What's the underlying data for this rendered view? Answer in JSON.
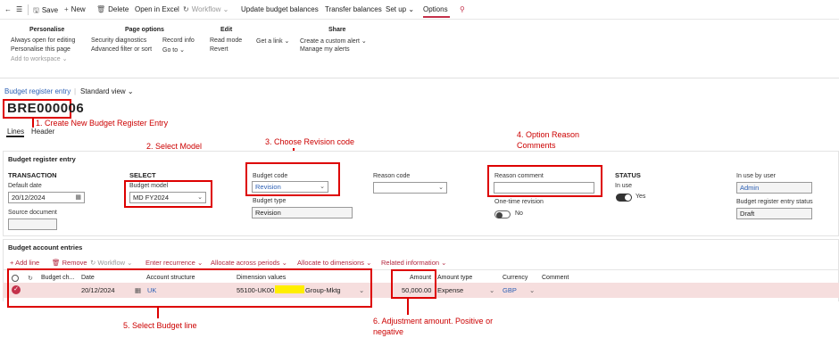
{
  "toolbar": {
    "save": "Save",
    "new": "New",
    "delete": "Delete",
    "open_in_excel": "Open in Excel",
    "workflow": "Workflow",
    "update_budget_balances": "Update budget balances",
    "transfer_balances": "Transfer balances",
    "set_up": "Set up",
    "options": "Options"
  },
  "ribbon": {
    "personalise": {
      "title": "Personalise",
      "items": [
        "Always open for editing",
        "Personalise this page",
        "Add to workspace"
      ]
    },
    "page_options": {
      "title": "Page options",
      "col1": [
        "Security diagnostics",
        "Advanced filter or sort"
      ],
      "col2": [
        "Record info",
        "Go to"
      ]
    },
    "edit": {
      "title": "Edit",
      "items": [
        "Read mode",
        "Revert"
      ]
    },
    "get_a_link": "Get a link",
    "share": {
      "title": "Share",
      "items": [
        "Create a custom alert",
        "Manage my alerts"
      ]
    }
  },
  "breadcrumb": {
    "link": "Budget register entry",
    "view": "Standard view"
  },
  "record_title": "BRE000006",
  "tabs": [
    "Lines",
    "Header"
  ],
  "annotations": {
    "a1": "1. Create New Budget Register Entry",
    "a2": "2. Select Model",
    "a3": "3. Choose Revision code",
    "a4_line1": "4. Option Reason",
    "a4_line2": "Comments",
    "a5": "5. Select Budget line",
    "a6_line1": "6. Adjustment amount. Positive or",
    "a6_line2": "negative"
  },
  "entry": {
    "panel_title": "Budget register entry",
    "transaction_h": "TRANSACTION",
    "default_date_label": "Default date",
    "default_date": "20/12/2024",
    "source_document_label": "Source document",
    "source_document": "",
    "select_h": "SELECT",
    "budget_model_label": "Budget model",
    "budget_model": "MD FY2024",
    "budget_code_label": "Budget code",
    "budget_code": "Revision",
    "budget_type_label": "Budget type",
    "budget_type": "Revision",
    "reason_code_label": "Reason code",
    "reason_code": "",
    "reason_comment_label": "Reason comment",
    "reason_comment": "",
    "one_time_revision_label": "One-time revision",
    "one_time_revision": "No",
    "status_h": "STATUS",
    "in_use_label": "In use",
    "in_use": "Yes",
    "in_use_by_user_label": "In use by user",
    "in_use_by_user": "Admin",
    "entry_status_label": "Budget register entry status",
    "entry_status": "Draft"
  },
  "accounts": {
    "panel_title": "Budget account entries",
    "actions": {
      "add_line": "Add line",
      "remove": "Remove",
      "workflow": "Workflow",
      "enter_recurrence": "Enter recurrence",
      "allocate_periods": "Allocate across periods",
      "allocate_dimensions": "Allocate to dimensions",
      "related_information": "Related information"
    },
    "columns": [
      "Budget ch...",
      "Date",
      "Account structure",
      "Dimension values",
      "Amount",
      "Amount type",
      "Currency",
      "Comment"
    ],
    "rows": [
      {
        "date": "20/12/2024",
        "account_structure": "UK",
        "dimension_prefix": "55100-UK00",
        "dimension_suffix": "Group-Mktg",
        "amount": "50,000.00",
        "amount_type": "Expense",
        "currency": "GBP",
        "comment": ""
      }
    ]
  },
  "colors": {
    "accent": "#c4314b",
    "annotation_red": "#dd0000",
    "link_blue": "#2b5fb4",
    "row_selected": "#f6dede",
    "highlight_yellow": "#ffee00"
  }
}
